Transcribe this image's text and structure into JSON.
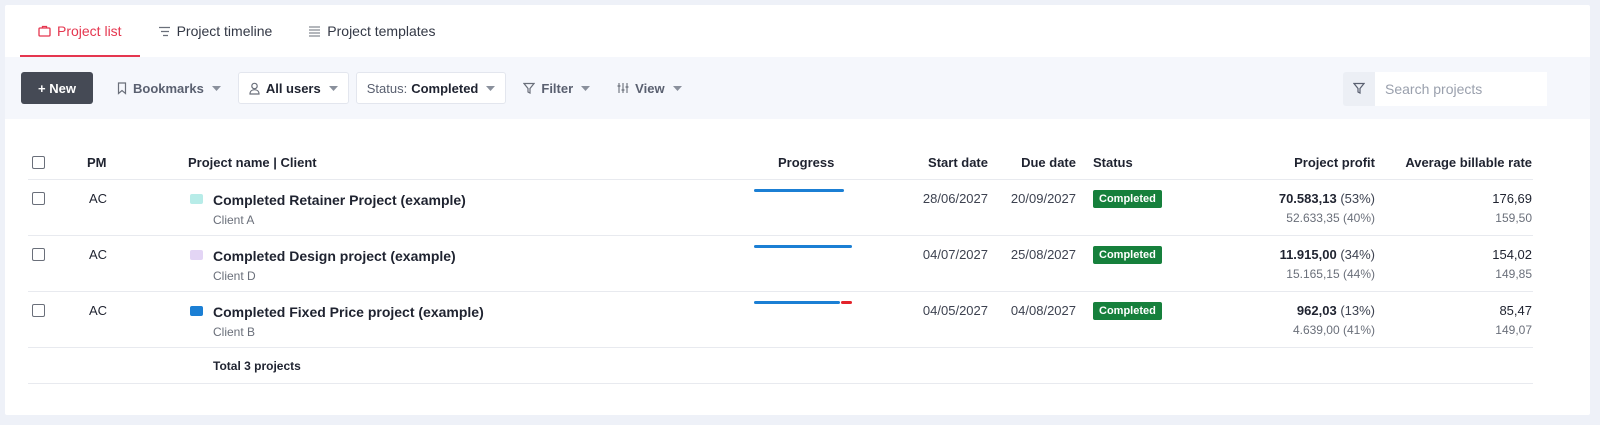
{
  "tabs": [
    {
      "label": "Project list",
      "icon": "briefcase-icon"
    },
    {
      "label": "Project timeline",
      "icon": "timeline-icon"
    },
    {
      "label": "Project templates",
      "icon": "list-icon"
    }
  ],
  "toolbar": {
    "new_label": "+ New",
    "bookmarks_label": "Bookmarks",
    "users_label": "All users",
    "status_prefix": "Status:",
    "status_value": "Completed",
    "filter_label": "Filter",
    "view_label": "View",
    "search_placeholder": "Search projects"
  },
  "table": {
    "headers": {
      "pm": "PM",
      "name": "Project name | Client",
      "progress": "Progress",
      "start": "Start date",
      "due": "Due date",
      "status": "Status",
      "profit": "Project profit",
      "rate": "Average billable rate"
    },
    "rows": [
      {
        "pm": "AC",
        "icon_color": "#b7ece8",
        "name": "Completed Retainer Project (example)",
        "client": "Client A",
        "progress_blue": 0.9,
        "progress_red": 0,
        "start": "28/06/2027",
        "due": "20/09/2027",
        "status": "Completed",
        "profit_main": "70.583,13",
        "profit_pct": "(53%)",
        "profit_sub": "52.633,35 (40%)",
        "rate_main": "176,69",
        "rate_sub": "159,50"
      },
      {
        "pm": "AC",
        "icon_color": "#e3d5f5",
        "name": "Completed Design project (example)",
        "client": "Client D",
        "progress_blue": 1.0,
        "progress_red": 0,
        "start": "04/07/2027",
        "due": "25/08/2027",
        "status": "Completed",
        "profit_main": "11.915,00",
        "profit_pct": "(34%)",
        "profit_sub": "15.165,15 (44%)",
        "rate_main": "154,02",
        "rate_sub": "149,85"
      },
      {
        "pm": "AC",
        "icon_color": "#1b7fd4",
        "name": "Completed Fixed Price project (example)",
        "client": "Client B",
        "progress_blue": 0.88,
        "progress_red": 0.12,
        "start": "04/05/2027",
        "due": "04/08/2027",
        "status": "Completed",
        "profit_main": "962,03",
        "profit_pct": "(13%)",
        "profit_sub": "4.639,00 (41%)",
        "rate_main": "85,47",
        "rate_sub": "149,07"
      }
    ],
    "total_label": "Total 3 projects"
  },
  "colors": {
    "accent": "#e5364f",
    "badge": "#16803c",
    "progress_blue": "#1b7fd4",
    "progress_red": "#e3232b"
  }
}
